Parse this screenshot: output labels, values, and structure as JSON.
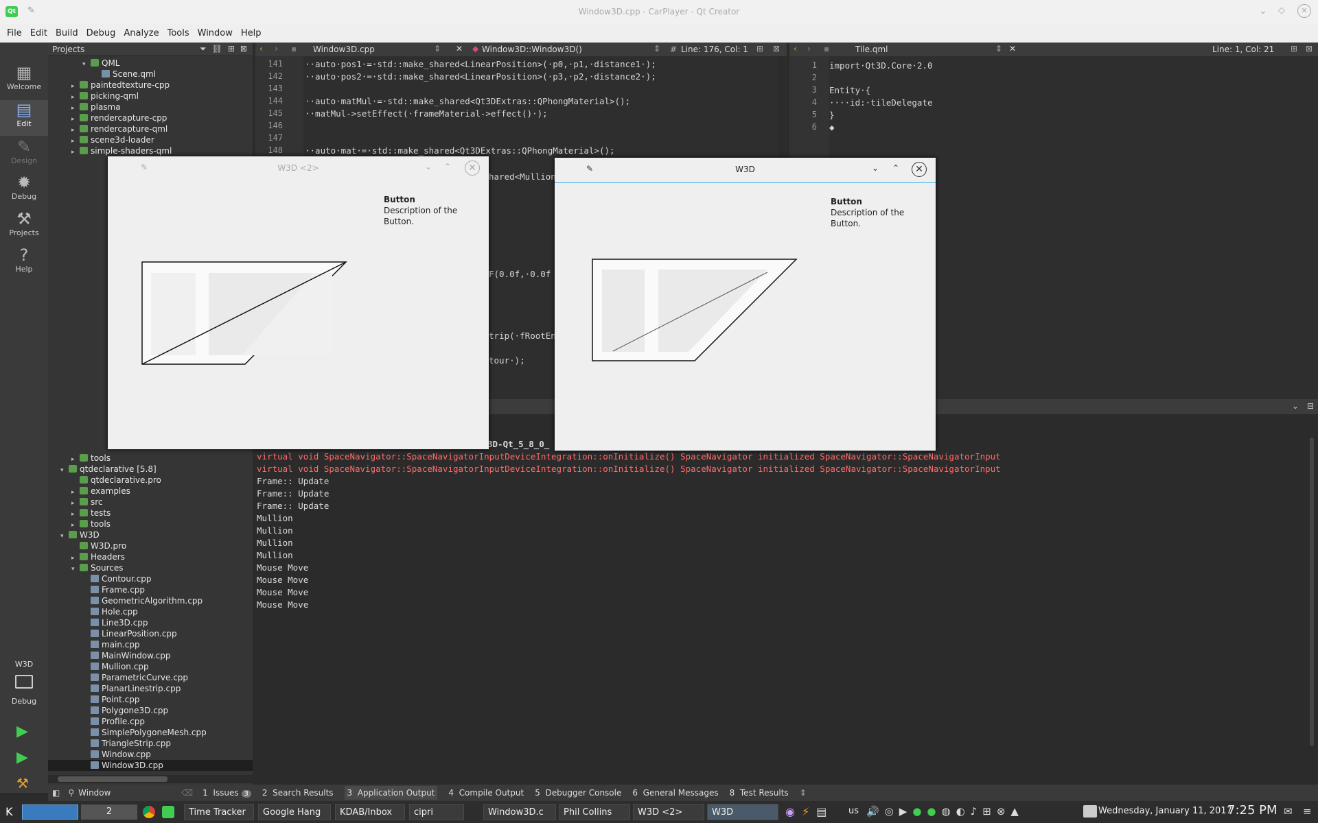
{
  "window": {
    "title": "Window3D.cpp - CarPlayer - Qt Creator"
  },
  "menu": [
    "File",
    "Edit",
    "Build",
    "Debug",
    "Analyze",
    "Tools",
    "Window",
    "Help"
  ],
  "modes": [
    {
      "label": "Welcome",
      "icon": "grid-icon"
    },
    {
      "label": "Edit",
      "icon": "edit-icon"
    },
    {
      "label": "Design",
      "icon": "pencil-icon"
    },
    {
      "label": "Debug",
      "icon": "bug-icon"
    },
    {
      "label": "Projects",
      "icon": "wrench-icon"
    },
    {
      "label": "Help",
      "icon": "help-icon"
    }
  ],
  "kit": {
    "project": "W3D",
    "build": "Debug"
  },
  "projects_panel": {
    "title": "Projects"
  },
  "tree_top": [
    {
      "label": "QML",
      "indent": 2,
      "arrow": "▾"
    },
    {
      "label": "Scene.qml",
      "indent": 3,
      "arrow": ""
    },
    {
      "label": "paintedtexture-cpp",
      "indent": 1,
      "arrow": "▸"
    },
    {
      "label": "picking-qml",
      "indent": 1,
      "arrow": "▸"
    },
    {
      "label": "plasma",
      "indent": 1,
      "arrow": "▸"
    },
    {
      "label": "rendercapture-cpp",
      "indent": 1,
      "arrow": "▸"
    },
    {
      "label": "rendercapture-qml",
      "indent": 1,
      "arrow": "▸"
    },
    {
      "label": "scene3d-loader",
      "indent": 1,
      "arrow": "▸"
    },
    {
      "label": "simple-shaders-qml",
      "indent": 1,
      "arrow": "▸"
    }
  ],
  "tree_bottom": [
    {
      "label": "tools",
      "indent": 1,
      "arrow": "▸"
    },
    {
      "label": "qtdeclarative [5.8]",
      "indent": 0,
      "arrow": "▾"
    },
    {
      "label": "qtdeclarative.pro",
      "indent": 1,
      "arrow": ""
    },
    {
      "label": "examples",
      "indent": 1,
      "arrow": "▸"
    },
    {
      "label": "src",
      "indent": 1,
      "arrow": "▸"
    },
    {
      "label": "tests",
      "indent": 1,
      "arrow": "▸"
    },
    {
      "label": "tools",
      "indent": 1,
      "arrow": "▸"
    },
    {
      "label": "W3D",
      "indent": 0,
      "arrow": "▾"
    },
    {
      "label": "W3D.pro",
      "indent": 1,
      "arrow": ""
    },
    {
      "label": "Headers",
      "indent": 1,
      "arrow": "▸"
    },
    {
      "label": "Sources",
      "indent": 1,
      "arrow": "▾"
    },
    {
      "label": "Contour.cpp",
      "indent": 2,
      "arrow": ""
    },
    {
      "label": "Frame.cpp",
      "indent": 2,
      "arrow": ""
    },
    {
      "label": "GeometricAlgorithm.cpp",
      "indent": 2,
      "arrow": ""
    },
    {
      "label": "Hole.cpp",
      "indent": 2,
      "arrow": ""
    },
    {
      "label": "Line3D.cpp",
      "indent": 2,
      "arrow": ""
    },
    {
      "label": "LinearPosition.cpp",
      "indent": 2,
      "arrow": ""
    },
    {
      "label": "main.cpp",
      "indent": 2,
      "arrow": ""
    },
    {
      "label": "MainWindow.cpp",
      "indent": 2,
      "arrow": ""
    },
    {
      "label": "Mullion.cpp",
      "indent": 2,
      "arrow": ""
    },
    {
      "label": "ParametricCurve.cpp",
      "indent": 2,
      "arrow": ""
    },
    {
      "label": "PlanarLinestrip.cpp",
      "indent": 2,
      "arrow": ""
    },
    {
      "label": "Point.cpp",
      "indent": 2,
      "arrow": ""
    },
    {
      "label": "Polygone3D.cpp",
      "indent": 2,
      "arrow": ""
    },
    {
      "label": "Profile.cpp",
      "indent": 2,
      "arrow": ""
    },
    {
      "label": "SimplePolygoneMesh.cpp",
      "indent": 2,
      "arrow": ""
    },
    {
      "label": "TriangleStrip.cpp",
      "indent": 2,
      "arrow": ""
    },
    {
      "label": "Window.cpp",
      "indent": 2,
      "arrow": ""
    },
    {
      "label": "Window3D.cpp",
      "indent": 2,
      "arrow": "",
      "selected": true
    }
  ],
  "editor1": {
    "file": "Window3D.cpp",
    "symbol": "Window3D::Window3D()",
    "position": "Line: 176, Col: 1",
    "lines": [
      {
        "n": "141",
        "text": "··auto·pos1·=·std::make_shared<LinearPosition>(·p0,·p1,·distance1·);"
      },
      {
        "n": "142",
        "text": "··auto·pos2·=·std::make_shared<LinearPosition>(·p3,·p2,·distance2·);"
      },
      {
        "n": "143",
        "text": ""
      },
      {
        "n": "144",
        "text": "··auto·matMul·=·std::make_shared<Qt3DExtras::QPhongMaterial>();"
      },
      {
        "n": "145",
        "text": "··matMul->setEffect(·frameMaterial->effect()·);"
      },
      {
        "n": "146",
        "text": ""
      },
      {
        "n": "147",
        "text": ""
      },
      {
        "n": "148",
        "text": "··auto·mat·=·std::make_shared<Qt3DExtras::QPhongMaterial>();"
      }
    ],
    "peek": [
      {
        "text": "hared<Mullion"
      },
      {
        "text": "F(0.0f,·0.0f"
      },
      {
        "text": "trip(·fRootEn"
      },
      {
        "text": "tour·);"
      }
    ]
  },
  "editor2": {
    "file": "Tile.qml",
    "position": "Line: 1, Col: 21",
    "lines": [
      {
        "n": "1",
        "text": "import·Qt3D.Core·2.0"
      },
      {
        "n": "2",
        "text": ""
      },
      {
        "n": "3",
        "text": "Entity·{"
      },
      {
        "n": "4",
        "text": "····id:·tileDelegate"
      },
      {
        "n": "5",
        "text": "}"
      },
      {
        "n": "6",
        "text": "◆"
      }
    ]
  },
  "output": {
    "partial_header": "3D-Qt_5_8_0_",
    "lines": [
      {
        "text": "virtual void SpaceNavigator::SpaceNavigatorInputDeviceIntegration::onInitialize() SpaceNavigator initialized SpaceNavigator::SpaceNavigatorInput",
        "kind": "error"
      },
      {
        "text": "virtual void SpaceNavigator::SpaceNavigatorInputDeviceIntegration::onInitialize() SpaceNavigator initialized SpaceNavigator::SpaceNavigatorInput",
        "kind": "error"
      },
      {
        "text": "Frame:: Update",
        "kind": "normal"
      },
      {
        "text": "Frame:: Update",
        "kind": "normal"
      },
      {
        "text": "Frame:: Update",
        "kind": "normal"
      },
      {
        "text": "Mullion",
        "kind": "normal"
      },
      {
        "text": "Mullion",
        "kind": "normal"
      },
      {
        "text": "Mullion",
        "kind": "normal"
      },
      {
        "text": "Mullion",
        "kind": "normal"
      },
      {
        "text": "Mouse Move",
        "kind": "normal"
      },
      {
        "text": "Mouse Move",
        "kind": "normal"
      },
      {
        "text": "Mouse Move",
        "kind": "normal"
      },
      {
        "text": "Mouse Move",
        "kind": "normal"
      }
    ]
  },
  "bottom_tabs": [
    {
      "num": "1",
      "label": "Issues",
      "badge": "3"
    },
    {
      "num": "2",
      "label": "Search Results"
    },
    {
      "num": "3",
      "label": "Application Output",
      "current": true
    },
    {
      "num": "4",
      "label": "Compile Output"
    },
    {
      "num": "5",
      "label": "Debugger Console"
    },
    {
      "num": "6",
      "label": "General Messages"
    },
    {
      "num": "8",
      "label": "Test Results"
    }
  ],
  "locator": {
    "placeholder": "Window"
  },
  "w3d_window_a": {
    "title": "W3D <2>",
    "button_title": "Button",
    "button_desc": "Description of the Button."
  },
  "w3d_window_b": {
    "title": "W3D",
    "button_title": "Button",
    "button_desc": "Description of the Button."
  },
  "taskbar": {
    "desktop_num": "2",
    "tasks": [
      "Time Tracker",
      "Google Hang",
      "KDAB/Inbox",
      "cipri",
      "Window3D.c",
      "Phil Collins",
      "W3D <2>",
      "W3D"
    ],
    "keyboard_layout": "us",
    "date": "Wednesday, January 11, 2017",
    "time": "7:25 PM"
  },
  "colors": {
    "accent": "#41cd52",
    "error_text": "#ff6b6b"
  }
}
